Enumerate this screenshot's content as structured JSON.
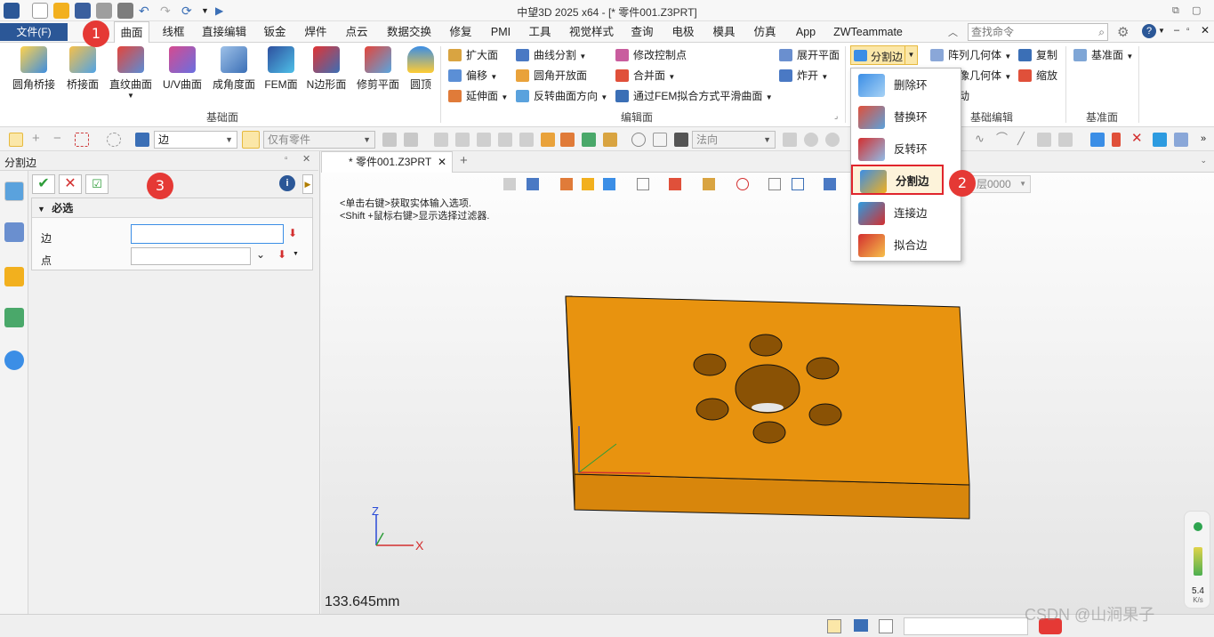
{
  "window": {
    "title": "中望3D 2025 x64 - [* 零件001.Z3PRT]"
  },
  "tabs": {
    "file": "文件(F)",
    "items": [
      "曲面",
      "线框",
      "直接编辑",
      "钣金",
      "焊件",
      "点云",
      "数据交换",
      "修复",
      "PMI",
      "工具",
      "视觉样式",
      "查询",
      "电极",
      "模具",
      "仿真",
      "App",
      "ZWTeammate"
    ],
    "active": "曲面",
    "search_placeholder": "查找命令"
  },
  "ribbon": {
    "group_basic": {
      "label": "基础面",
      "buttons": [
        "圆角桥接",
        "桥接面",
        "直纹曲面",
        "U/V曲面",
        "成角度面",
        "FEM面",
        "N边形面",
        "修剪平面",
        "圆顶"
      ]
    },
    "group_edit": {
      "label": "编辑面",
      "col1": [
        "扩大面",
        "偏移",
        "延伸面"
      ],
      "col2": [
        "曲线分割",
        "圆角开放面",
        "反转曲面方向"
      ],
      "col3": [
        "修改控制点",
        "合并面",
        "通过FEM拟合方式平滑曲面"
      ],
      "col4": [
        "展开平面",
        "炸开"
      ]
    },
    "group_basic_edit": {
      "label": "基础编辑",
      "split_button": "分割边",
      "col_a": [
        "阵列几何体",
        "镜像几何体",
        "移动"
      ],
      "col_b": [
        "复制",
        "缩放"
      ]
    },
    "group_datum": {
      "label": "基准面",
      "button": "基准面"
    }
  },
  "dropdown": {
    "items": [
      "删除环",
      "替换环",
      "反转环",
      "分割边",
      "连接边",
      "拟合边"
    ],
    "selected": "分割边"
  },
  "toolbar": {
    "filter_value": "边",
    "scope_value": "仅有零件",
    "direction_value": "法向",
    "layer_value": "层0000"
  },
  "panel": {
    "title": "分割边",
    "section": "必选",
    "fields": [
      {
        "label": "边",
        "value": ""
      },
      {
        "label": "点",
        "value": ""
      }
    ]
  },
  "document": {
    "tab": "* 零件001.Z3PRT",
    "hint_1": "<单击右键>获取实体输入选项.",
    "hint_2": "<Shift +鼠标右键>显示选择过滤器.",
    "measurement": "133.645mm",
    "axis_x": "X",
    "axis_z": "Z",
    "perf_value": "5.4",
    "perf_unit": "K/s"
  },
  "annotations": [
    "1",
    "2",
    "3"
  ],
  "watermark": "CSDN @山涧果子",
  "colors": {
    "accent": "#2b5797",
    "part": "#e8930f",
    "badge": "#e53935",
    "highlight": "#e0252c"
  }
}
